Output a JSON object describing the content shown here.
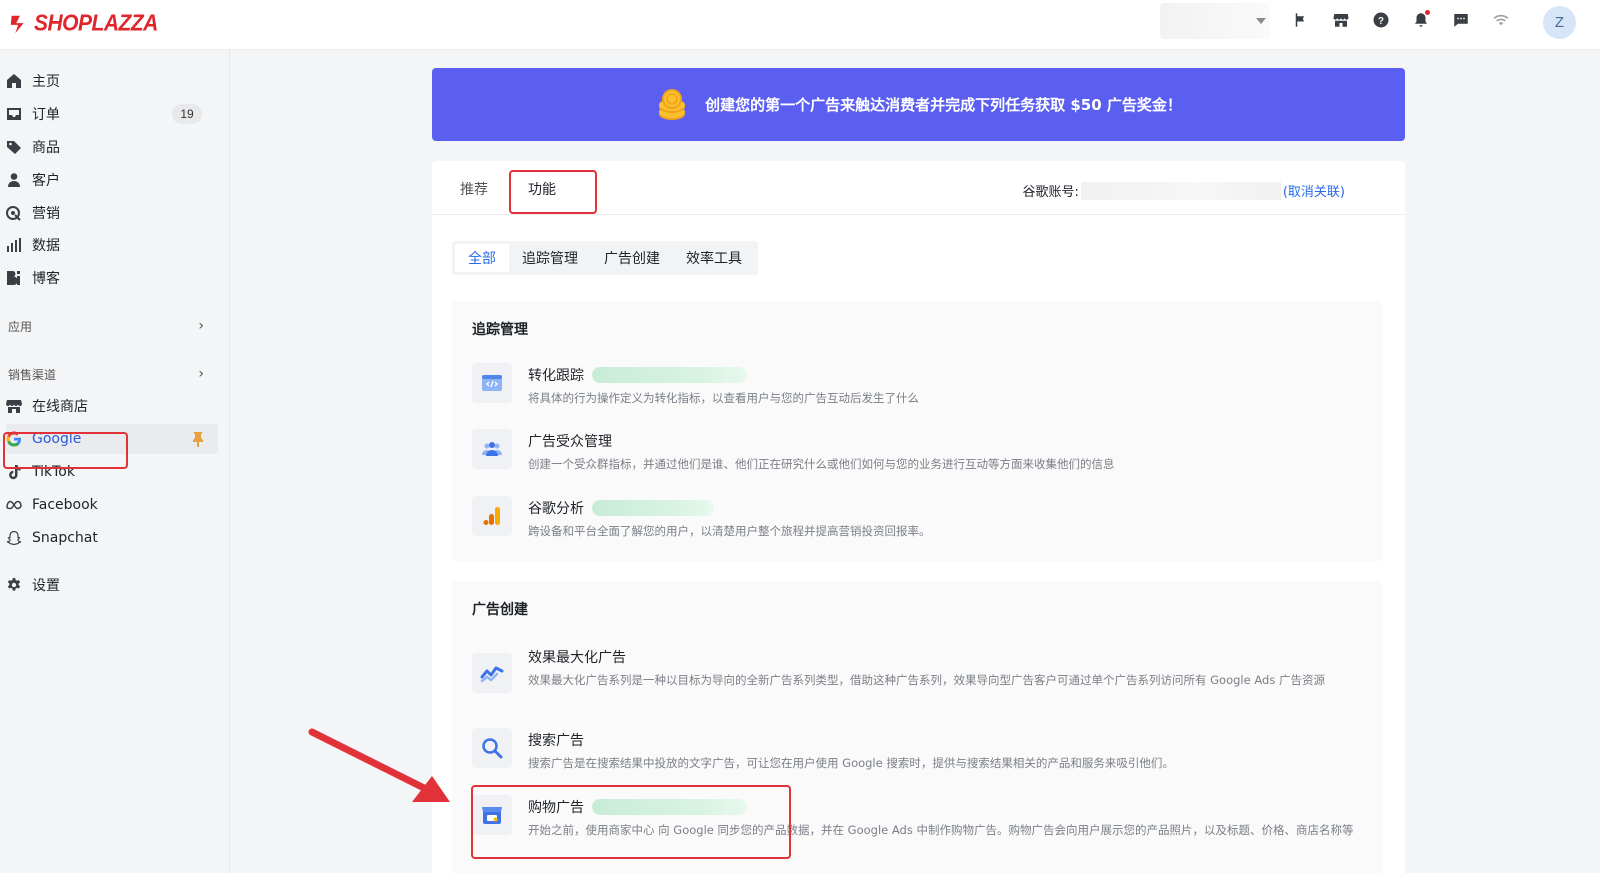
{
  "header": {
    "brand": "SHOPLAZZA",
    "avatar_initial": "Z",
    "icons": [
      "flag-icon",
      "store-icon",
      "help-icon",
      "bell-icon",
      "chat-icon",
      "wifi-icon"
    ]
  },
  "sidebar": {
    "items": [
      {
        "label": "主页",
        "icon": "home-icon"
      },
      {
        "label": "订单",
        "icon": "inbox-icon",
        "badge": "19"
      },
      {
        "label": "商品",
        "icon": "tag-icon"
      },
      {
        "label": "客户",
        "icon": "person-icon"
      },
      {
        "label": "营销",
        "icon": "marketing-icon"
      },
      {
        "label": "数据",
        "icon": "bar-chart-icon"
      },
      {
        "label": "博客",
        "icon": "blog-icon"
      }
    ],
    "apps_label": "应用",
    "channels_label": "销售渠道",
    "channels": [
      {
        "label": "在线商店",
        "icon": "store-icon"
      },
      {
        "label": "Google",
        "icon": "google-icon"
      },
      {
        "label": "TikTok",
        "icon": "tiktok-icon"
      },
      {
        "label": "Facebook",
        "icon": "meta-icon"
      },
      {
        "label": "Snapchat",
        "icon": "snapchat-icon"
      }
    ],
    "settings_label": "设置"
  },
  "banner": {
    "text": "创建您的第一个广告来触达消费者并完成下列任务获取 $50 广告奖金！"
  },
  "main": {
    "tabs": [
      {
        "label": "推荐"
      },
      {
        "label": "功能"
      }
    ],
    "account_label": "谷歌账号:",
    "unlink_label": "(取消关联)",
    "segments": [
      "全部",
      "追踪管理",
      "广告创建",
      "效率工具"
    ],
    "groups": [
      {
        "title": "追踪管理",
        "features": [
          {
            "title": "转化跟踪",
            "desc": "将具体的行为操作定义为转化指标，以查看用户与您的广告互动后发生了什么",
            "icon": "code-browser-icon"
          },
          {
            "title": "广告受众管理",
            "desc": "创建一个受众群指标，并通过他们是谁、他们正在研究什么或他们如何与您的业务进行互动等方面来收集他们的信息",
            "icon": "audience-icon"
          },
          {
            "title": "谷歌分析",
            "desc": "跨设备和平台全面了解您的用户，以清楚用户整个旅程并提高营销投资回报率。",
            "icon": "analytics-icon"
          }
        ]
      },
      {
        "title": "广告创建",
        "features": [
          {
            "title": "效果最大化广告",
            "desc": "效果最大化广告系列是一种以目标为导向的全新广告系列类型，借助这种广告系列，效果导向型广告客户可通过单个广告系列访问所有 Google Ads 广告资源",
            "icon": "performance-max-icon"
          },
          {
            "title": "搜索广告",
            "desc": "搜索广告是在搜索结果中投放的文字广告，可让您在用户使用 Google 搜索时，提供与搜索结果相关的产品和服务来吸引他们。",
            "icon": "search-icon"
          },
          {
            "title": "购物广告",
            "desc": "开始之前，使用商家中心 向 Google 同步您的产品数据，并在 Google Ads 中制作购物广告。购物广告会向用户展示您的产品照片，以及标题、价格、商店名称等",
            "icon": "shopping-store-icon"
          }
        ]
      }
    ]
  },
  "colors": {
    "banner": "#5b5ff1",
    "link": "#2a6be6",
    "highlight": "#e1323a",
    "brand": "#e0262d"
  }
}
